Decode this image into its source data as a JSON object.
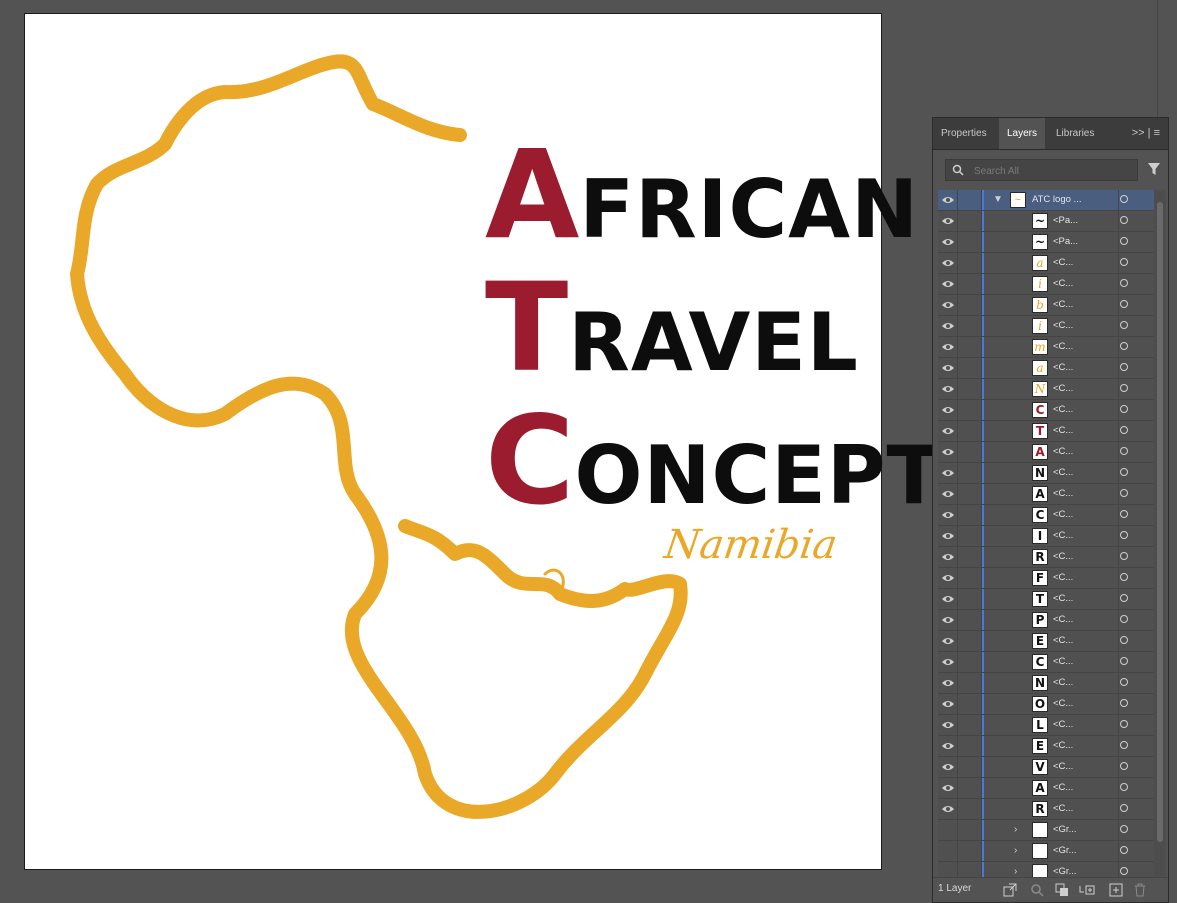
{
  "artboard": {
    "logo": {
      "lines": [
        {
          "cap": "A",
          "rest": "FRICAN"
        },
        {
          "cap": "T",
          "rest": "RAVEL"
        },
        {
          "cap": "C",
          "rest": "ONCEPT"
        }
      ],
      "subtitle": "Namibia",
      "colors": {
        "gold": "#eaa828",
        "maroon": "#9b1c2e",
        "black": "#0d0d0d"
      }
    }
  },
  "panel": {
    "tabs": [
      {
        "label": "Properties",
        "active": false
      },
      {
        "label": "Layers",
        "active": true
      },
      {
        "label": "Libraries",
        "active": false
      }
    ],
    "menu_glyph": ">>  |  ≡",
    "search": {
      "placeholder": "Search All",
      "value": ""
    },
    "top_layer": {
      "name": "ATC logo ..."
    },
    "rows": [
      {
        "glyph": "~",
        "style": "path",
        "name": "<Pa..."
      },
      {
        "glyph": "~",
        "style": "path",
        "name": "<Pa..."
      },
      {
        "glyph": "a",
        "style": "gold",
        "name": "<C..."
      },
      {
        "glyph": "i",
        "style": "gold",
        "name": "<C..."
      },
      {
        "glyph": "b",
        "style": "gold",
        "name": "<C..."
      },
      {
        "glyph": "i",
        "style": "gold",
        "name": "<C..."
      },
      {
        "glyph": "m",
        "style": "gold",
        "name": "<C..."
      },
      {
        "glyph": "a",
        "style": "gold",
        "name": "<C..."
      },
      {
        "glyph": "N",
        "style": "gold",
        "name": "<C..."
      },
      {
        "glyph": "C",
        "style": "red",
        "name": "<C..."
      },
      {
        "glyph": "T",
        "style": "red",
        "name": "<C..."
      },
      {
        "glyph": "A",
        "style": "red",
        "name": "<C..."
      },
      {
        "glyph": "N",
        "style": "black",
        "name": "<C..."
      },
      {
        "glyph": "A",
        "style": "black",
        "name": "<C..."
      },
      {
        "glyph": "C",
        "style": "black",
        "name": "<C..."
      },
      {
        "glyph": "I",
        "style": "black",
        "name": "<C..."
      },
      {
        "glyph": "R",
        "style": "black",
        "name": "<C..."
      },
      {
        "glyph": "F",
        "style": "black",
        "name": "<C..."
      },
      {
        "glyph": "T",
        "style": "black",
        "name": "<C..."
      },
      {
        "glyph": "P",
        "style": "black",
        "name": "<C..."
      },
      {
        "glyph": "E",
        "style": "black",
        "name": "<C..."
      },
      {
        "glyph": "C",
        "style": "black",
        "name": "<C..."
      },
      {
        "glyph": "N",
        "style": "black",
        "name": "<C..."
      },
      {
        "glyph": "O",
        "style": "black",
        "name": "<C..."
      },
      {
        "glyph": "L",
        "style": "black",
        "name": "<C..."
      },
      {
        "glyph": "E",
        "style": "black",
        "name": "<C..."
      },
      {
        "glyph": "V",
        "style": "black",
        "name": "<C..."
      },
      {
        "glyph": "A",
        "style": "black",
        "name": "<C..."
      },
      {
        "glyph": "R",
        "style": "black",
        "name": "<C..."
      }
    ],
    "groups": [
      {
        "name": "<Gr..."
      },
      {
        "name": "<Gr..."
      },
      {
        "name": "<Gr..."
      }
    ],
    "footer": {
      "layer_count": "1 Layer",
      "icons": [
        "export-icon",
        "locate-icon",
        "clipping-mask-icon",
        "new-sublayer-icon",
        "new-layer-icon",
        "delete-icon"
      ]
    },
    "colors": {
      "accent": "#4a7bd4",
      "selected_row": "#4a5e80"
    }
  }
}
